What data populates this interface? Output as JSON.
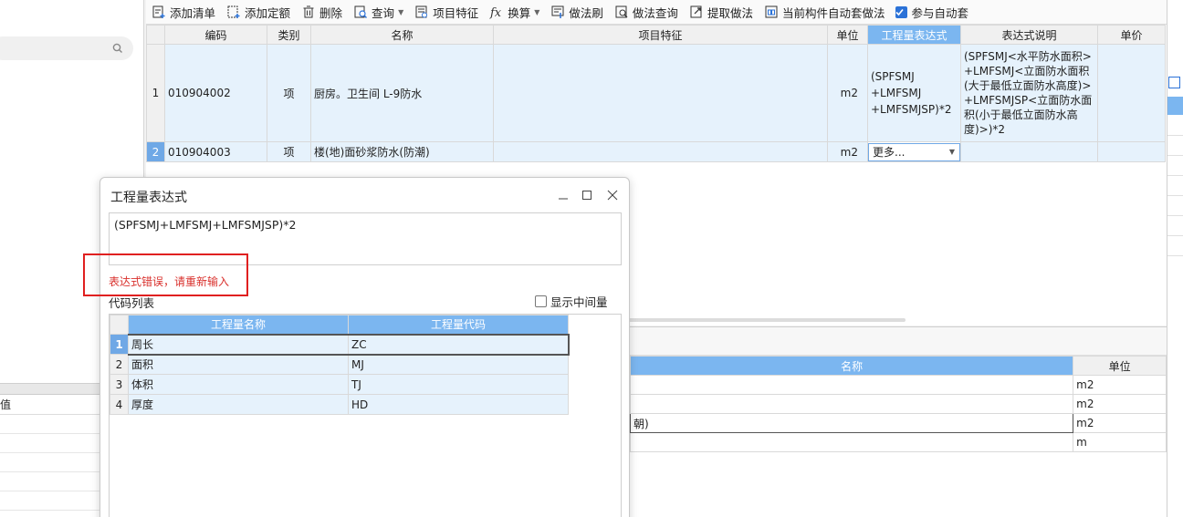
{
  "toolbar": {
    "items": [
      {
        "label": "添加清单",
        "icon": "add-list-icon"
      },
      {
        "label": "添加定额",
        "icon": "add-quota-icon"
      },
      {
        "label": "删除",
        "icon": "trash-icon"
      },
      {
        "label": "查询",
        "icon": "query-icon"
      },
      {
        "label": "项目特征",
        "icon": "feature-icon"
      },
      {
        "label": "换算",
        "icon": "fx-icon"
      },
      {
        "label": "做法刷",
        "icon": "brush-icon"
      },
      {
        "label": "做法查询",
        "icon": "method-query-icon"
      },
      {
        "label": "提取做法",
        "icon": "extract-icon"
      },
      {
        "label": "当前构件自动套做法",
        "icon": "auto-apply-icon"
      }
    ],
    "participate_label": "参与自动套"
  },
  "main_grid": {
    "headers": [
      "编码",
      "类别",
      "名称",
      "项目特征",
      "单位",
      "工程量表达式",
      "表达式说明",
      "单价"
    ],
    "rows": [
      {
        "num": "1",
        "code": "010904002",
        "type": "项",
        "name": "厨房。卫生间 L-9防水",
        "feature": "",
        "unit": "m2",
        "expr_lines": [
          "(SPFSMJ",
          "+LMFSMJ",
          "+LMFSMJSP)*2"
        ],
        "desc_lines": [
          "(SPFSMJ<水平防水面积>",
          "+LMFSMJ<立面防水面积",
          "(大于最低立面防水高度)>",
          "+LMFSMJSP<立面防水面",
          "积(小于最低立面防水高",
          "度)>)*2"
        ],
        "price": ""
      },
      {
        "num": "2",
        "code": "010904003",
        "type": "项",
        "name": "楼(地)面砂浆防水(防潮)",
        "feature": "",
        "unit": "m2",
        "expr_dropdown": "更多...",
        "desc": "",
        "price": ""
      }
    ]
  },
  "bottom_grid": {
    "headers": [
      "名称",
      "单位"
    ],
    "rows": [
      {
        "name": "",
        "unit": "m2"
      },
      {
        "name": "",
        "unit": "m2"
      },
      {
        "name": "朝)",
        "unit": "m2"
      },
      {
        "name": "",
        "unit": "m"
      }
    ]
  },
  "left_panel": {
    "value_header": "值"
  },
  "dialog": {
    "title": "工程量表达式",
    "expression": "(SPFSMJ+LMFSMJ+LMFSMJSP)*2",
    "error": "表达式错误，请重新输入",
    "code_list_label": "代码列表",
    "show_intermediate_label": "显示中间量",
    "code_grid": {
      "headers": [
        "工程量名称",
        "工程量代码"
      ],
      "rows": [
        {
          "num": "1",
          "name": "周长",
          "code": "ZC"
        },
        {
          "num": "2",
          "name": "面积",
          "code": "MJ"
        },
        {
          "num": "3",
          "name": "体积",
          "code": "TJ"
        },
        {
          "num": "4",
          "name": "厚度",
          "code": "HD"
        }
      ]
    },
    "colors": {
      "error": "#d9302c",
      "header": "#7bb6f0",
      "highlight": "#e02020"
    }
  }
}
